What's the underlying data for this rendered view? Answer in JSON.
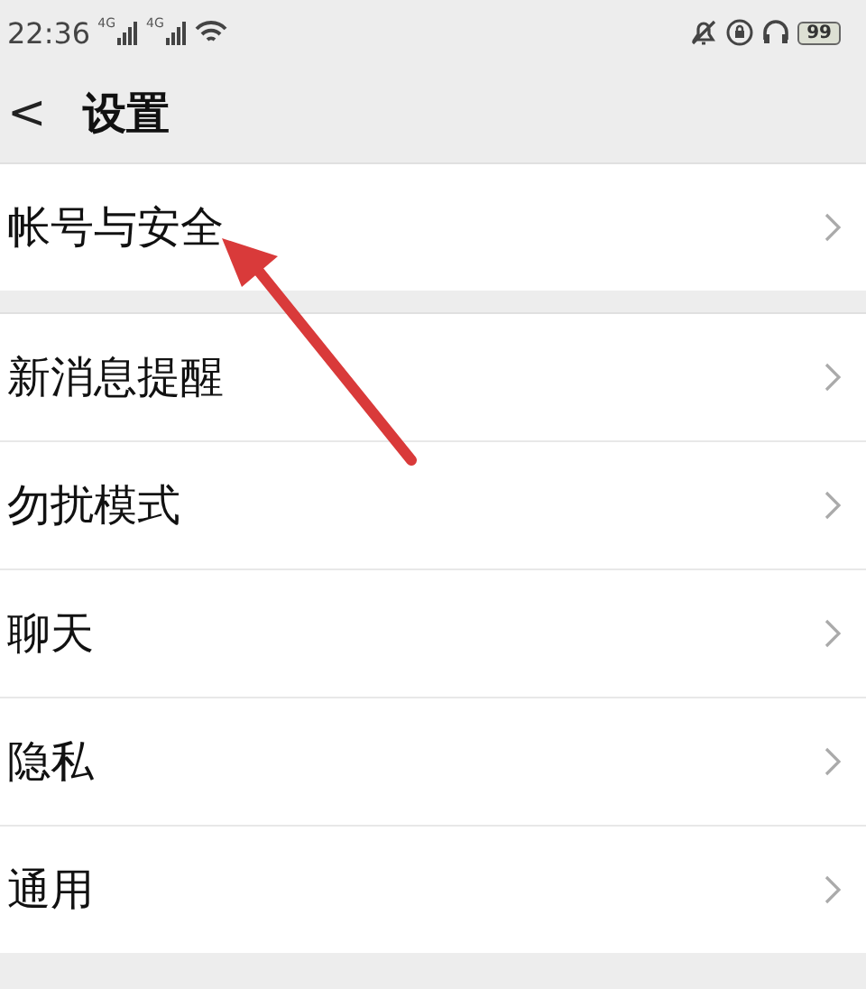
{
  "status_bar": {
    "time": "22:36",
    "signals": [
      {
        "network": "4G"
      },
      {
        "network": "4G"
      }
    ],
    "battery": "99"
  },
  "header": {
    "back": "<",
    "title": "设置"
  },
  "groups": [
    {
      "items": [
        {
          "label": "帐号与安全"
        }
      ]
    },
    {
      "items": [
        {
          "label": "新消息提醒"
        },
        {
          "label": "勿扰模式"
        },
        {
          "label": "聊天"
        },
        {
          "label": "隐私"
        },
        {
          "label": "通用"
        }
      ]
    }
  ]
}
